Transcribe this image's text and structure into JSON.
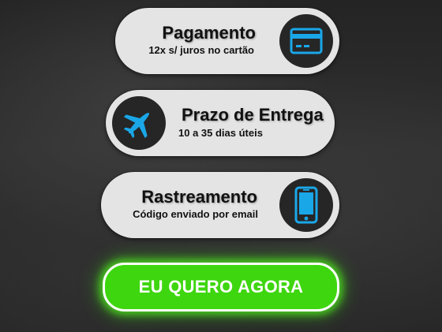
{
  "colors": {
    "pill_background": "#e4e4e4",
    "icon_circle": "#262626",
    "icon_accent": "#1aa7e8",
    "cta_green": "#3ed60e",
    "cta_text": "#ffffff"
  },
  "cards": [
    {
      "title": "Pagamento",
      "subtitle": "12x s/ juros no cartão",
      "icon": "credit-card-icon"
    },
    {
      "title": "Prazo de Entrega",
      "subtitle": "10 a 35 dias úteis",
      "icon": "airplane-icon"
    },
    {
      "title": "Rastreamento",
      "subtitle": "Código enviado por email",
      "icon": "smartphone-icon"
    }
  ],
  "cta": {
    "label": "EU QUERO AGORA"
  }
}
